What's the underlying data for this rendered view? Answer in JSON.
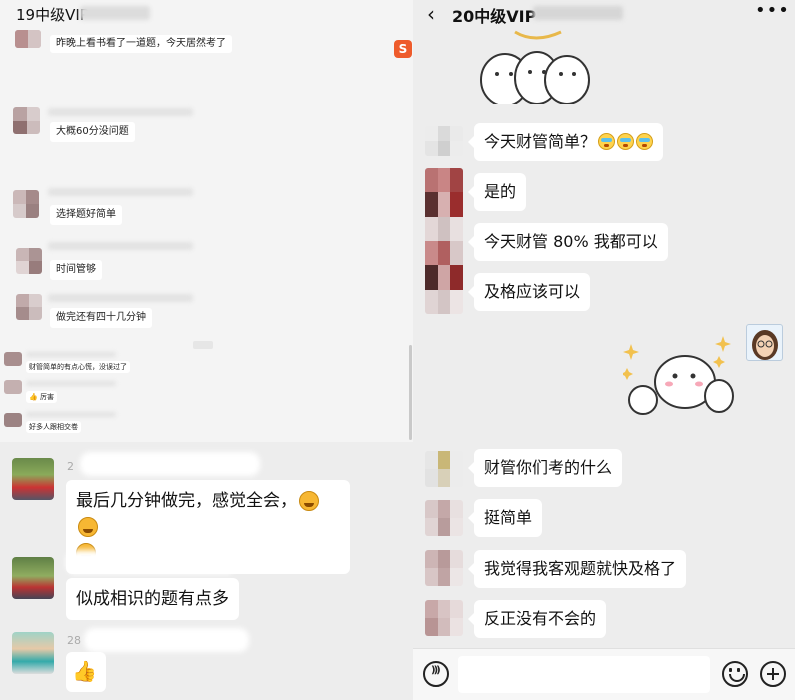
{
  "left_chat": {
    "title": "19中级VIP",
    "small_messages": [
      "昨晚上看书看了一道题，今天居然考了",
      "大概60分没问题",
      "选择题好简单",
      "时间管够",
      "做完还有四十几分钟"
    ],
    "tiny_messages": [
      "财管简单的有点心慌，没误过了",
      "厉害",
      "好多人跟相交卷"
    ],
    "big_messages": [
      {
        "num": "2",
        "text": "最后几分钟做完，感觉全会，"
      },
      {
        "num": "",
        "text": "似成相识的题有点多"
      },
      {
        "num": "28",
        "text": ""
      }
    ],
    "sogou_label": "S"
  },
  "right_chat": {
    "title": "20中级VIP",
    "back_icon": "chevron-left-icon",
    "more_icon": "more-dots-icon",
    "messages": [
      "今天财管简单？",
      "是的",
      "今天财管 80% 我都可以",
      "及格应该可以",
      "财管你们考的什么",
      "挺简单",
      "我觉得我客观题就快及格了",
      "反正没有不会的"
    ]
  },
  "input_bar": {
    "voice_icon": "voice-icon",
    "emoji_icon": "emoji-icon",
    "plus_icon": "plus-icon",
    "placeholder": ""
  }
}
